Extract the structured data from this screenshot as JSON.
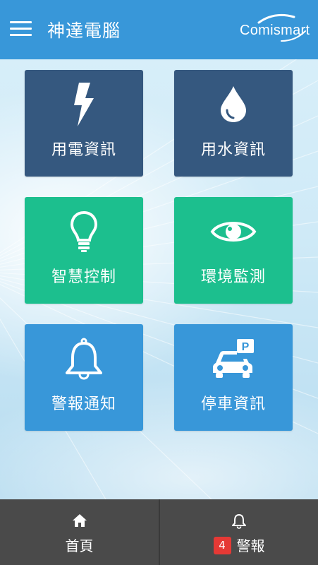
{
  "header": {
    "title": "神達電腦",
    "logo_text": "Comismart"
  },
  "tiles": [
    {
      "label": "用電資訊",
      "icon": "lightning-icon",
      "color": "#35587f"
    },
    {
      "label": "用水資訊",
      "icon": "water-drop-icon",
      "color": "#35587f"
    },
    {
      "label": "智慧控制",
      "icon": "lightbulb-icon",
      "color": "#1cbf8e"
    },
    {
      "label": "環境監測",
      "icon": "eye-icon",
      "color": "#1cbf8e"
    },
    {
      "label": "警報通知",
      "icon": "bell-icon",
      "color": "#3897d9"
    },
    {
      "label": "停車資訊",
      "icon": "parking-car-icon",
      "color": "#3897d9"
    }
  ],
  "footer": {
    "home_label": "首頁",
    "home_icon": "home-icon",
    "alerts_label": "警報",
    "alerts_icon": "bell-icon",
    "alerts_count": "4",
    "background": "#4a4a4a",
    "badge_color": "#e53935"
  }
}
